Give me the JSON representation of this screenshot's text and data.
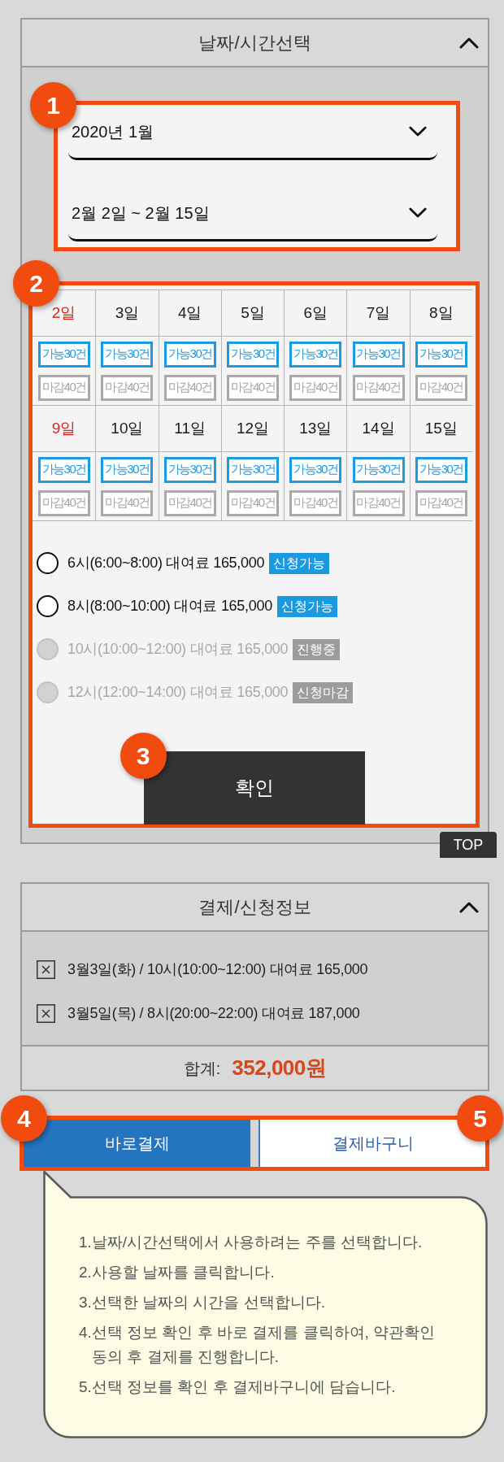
{
  "date_time_panel": {
    "title": "날짜/시간선택",
    "expanded": true,
    "selectors": {
      "callout": "1",
      "month": "2020년 1월",
      "period": "2월 2일 ~ 2월 15일"
    },
    "schedule": {
      "callout": "2",
      "weeks": [
        {
          "days": [
            {
              "day": "2일",
              "holiday": true,
              "available": "가능30건",
              "closed": "마감40건"
            },
            {
              "day": "3일",
              "holiday": false,
              "available": "가능30건",
              "closed": "마감40건"
            },
            {
              "day": "4일",
              "holiday": false,
              "available": "가능30건",
              "closed": "마감40건"
            },
            {
              "day": "5일",
              "holiday": false,
              "available": "가능30건",
              "closed": "마감40건"
            },
            {
              "day": "6일",
              "holiday": false,
              "available": "가능30건",
              "closed": "마감40건"
            },
            {
              "day": "7일",
              "holiday": false,
              "available": "가능30건",
              "closed": "마감40건"
            },
            {
              "day": "8일",
              "holiday": false,
              "available": "가능30건",
              "closed": "마감40건"
            }
          ]
        },
        {
          "days": [
            {
              "day": "9일",
              "holiday": true,
              "available": "가능30건",
              "closed": "마감40건"
            },
            {
              "day": "10일",
              "holiday": false,
              "available": "가능30건",
              "closed": "마감40건"
            },
            {
              "day": "11일",
              "holiday": false,
              "available": "가능30건",
              "closed": "마감40건"
            },
            {
              "day": "12일",
              "holiday": false,
              "available": "가능30건",
              "closed": "마감40건"
            },
            {
              "day": "13일",
              "holiday": false,
              "available": "가능30건",
              "closed": "마감40건"
            },
            {
              "day": "14일",
              "holiday": false,
              "available": "가능30건",
              "closed": "마감40건"
            },
            {
              "day": "15일",
              "holiday": false,
              "available": "가능30건",
              "closed": "마감40건"
            }
          ]
        }
      ],
      "time_slots": [
        {
          "label": "6시(6:00~8:00) 대여료 165,000",
          "status": "신청가능",
          "selected": false,
          "disabled": false
        },
        {
          "label": "8시(8:00~10:00) 대여료 165,000",
          "status": "신청가능",
          "selected": false,
          "disabled": false
        },
        {
          "label": "10시(10:00~12:00) 대여료 165,000",
          "status": "진행중",
          "selected": false,
          "disabled": true
        },
        {
          "label": "12시(12:00~14:00) 대여료 165,000",
          "status": "신청마감",
          "selected": false,
          "disabled": true
        }
      ],
      "confirm": {
        "label": "확인",
        "callout": "3"
      }
    }
  },
  "top_button": "TOP",
  "payment_panel": {
    "title": "결제/신청정보",
    "expanded": true,
    "items": [
      "3월3일(화) / 10시(10:00~12:00) 대여료 165,000",
      "3월5일(목) / 8시(20:00~22:00) 대여료 187,000"
    ],
    "total_label": "합계:",
    "total_value": "352,000원"
  },
  "action_buttons": [
    {
      "kind": "primary",
      "label": "바로결제",
      "callout": "4"
    },
    {
      "kind": "secondary",
      "label": "결제바구니",
      "callout": "5"
    }
  ],
  "help_bubble": {
    "lines": [
      "1.날짜/시간선택에서 사용하려는 주를 선택합니다.",
      "2.사용할 날짜를 클릭합니다.",
      "3.선택한 날짜의 시간을 선택합니다.",
      "4.선택 정보 확인 후 바로 결제를 클릭하여, 약관확인 동의 후 결제를 진행합니다.",
      "5.선택 정보를 확인 후 결제바구니에 담습니다."
    ]
  }
}
